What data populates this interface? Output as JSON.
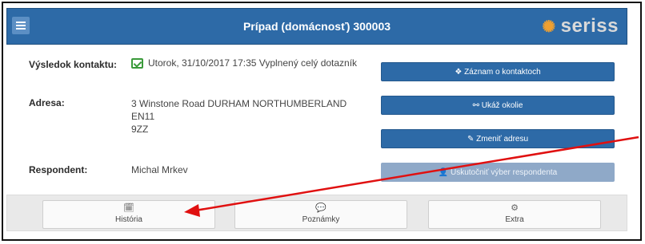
{
  "header": {
    "title": "Prípad (domácnosť) 300003",
    "logo_text": "seriss",
    "menu_icon": "hamburger-icon",
    "colors": {
      "header_bg": "#2d6aa7",
      "button_bg": "#2d6aa7",
      "button_disabled_bg": "#8fa9c8",
      "annotation_arrow": "#e01010"
    }
  },
  "details": {
    "contact_result": {
      "label": "Výsledok kontaktu:",
      "value": "Utorok, 31/10/2017 17:35 Vyplnený celý dotazník",
      "icon": "checkbox-checked-icon"
    },
    "address": {
      "label": "Adresa:",
      "line1": "3 Winstone Road DURHAM NORTHUMBERLAND EN11",
      "line2": "9ZZ"
    },
    "respondent": {
      "label": "Respondent:",
      "value": "Michal Mrkev"
    }
  },
  "actions": [
    {
      "label": "Záznam o kontaktoch",
      "icon": "diamond-icon",
      "icon_glyph": "❖",
      "enabled": true
    },
    {
      "label": "Ukáž okolie",
      "icon": "binoculars-icon",
      "icon_glyph": "⚯",
      "enabled": true
    },
    {
      "label": "Zmeniť adresu",
      "icon": "edit-icon",
      "icon_glyph": "✎",
      "enabled": true
    },
    {
      "label": "Uskutočniť výber respondenta",
      "icon": "user-icon",
      "icon_glyph": "👤",
      "enabled": false
    }
  ],
  "tabs": [
    {
      "label": "História",
      "icon": "calendar-icon",
      "icon_glyph": "🗓"
    },
    {
      "label": "Poznámky",
      "icon": "comment-icon",
      "icon_glyph": "💬"
    },
    {
      "label": "Extra",
      "icon": "gear-icon",
      "icon_glyph": "⚙"
    }
  ]
}
